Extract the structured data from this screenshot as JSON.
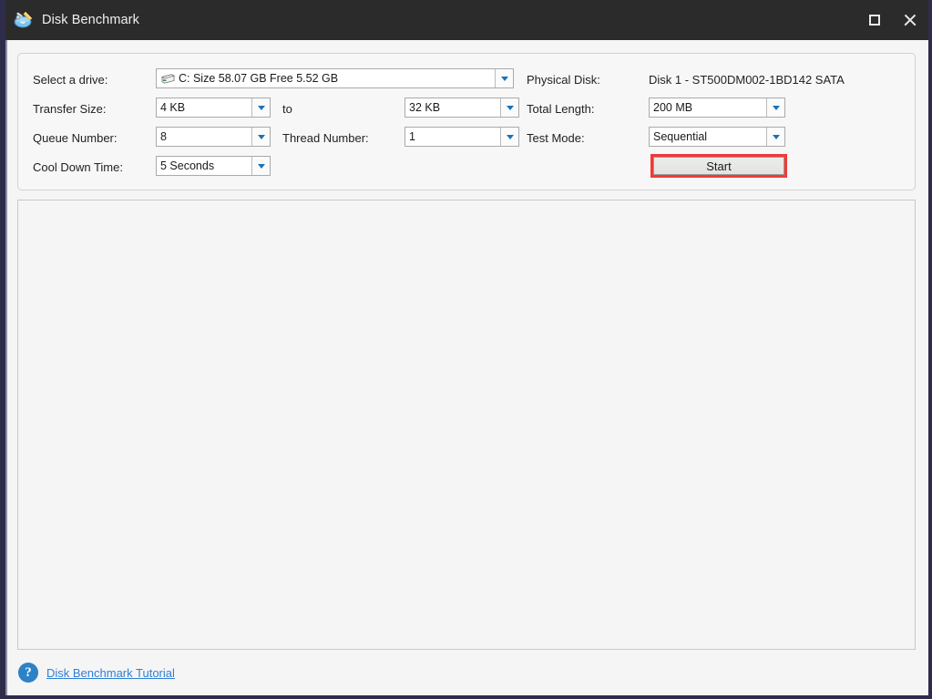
{
  "window": {
    "title": "Disk Benchmark",
    "app_icon": "disk-benchmark-app-icon",
    "maximize_icon": "maximize-icon",
    "close_icon": "close-icon",
    "accent_red": "#f03a36",
    "titlebar_color": "#2b2b2b",
    "link_color": "#2f7fd4"
  },
  "settings": {
    "drive": {
      "label": "Select a drive:",
      "icon": "hard-drive-icon",
      "value": "C:  Size 58.07 GB  Free 5.52 GB"
    },
    "physical_disk": {
      "label": "Physical Disk:",
      "value": "Disk 1 - ST500DM002-1BD142 SATA"
    },
    "transfer_size": {
      "label": "Transfer Size:",
      "value": "4 KB"
    },
    "transfer_to": {
      "label": "to",
      "value": "32 KB"
    },
    "total_length": {
      "label": "Total Length:",
      "value": "200 MB"
    },
    "queue_number": {
      "label": "Queue Number:",
      "value": "8"
    },
    "thread_number": {
      "label": "Thread Number:",
      "value": "1"
    },
    "test_mode": {
      "label": "Test Mode:",
      "value": "Sequential"
    },
    "cool_down_time": {
      "label": "Cool Down Time:",
      "value": "5 Seconds"
    },
    "start_button": {
      "label": "Start"
    }
  },
  "results": {
    "content": ""
  },
  "footer": {
    "help_icon": "help-icon",
    "help_glyph": "?",
    "tutorial_link": "Disk Benchmark Tutorial"
  }
}
